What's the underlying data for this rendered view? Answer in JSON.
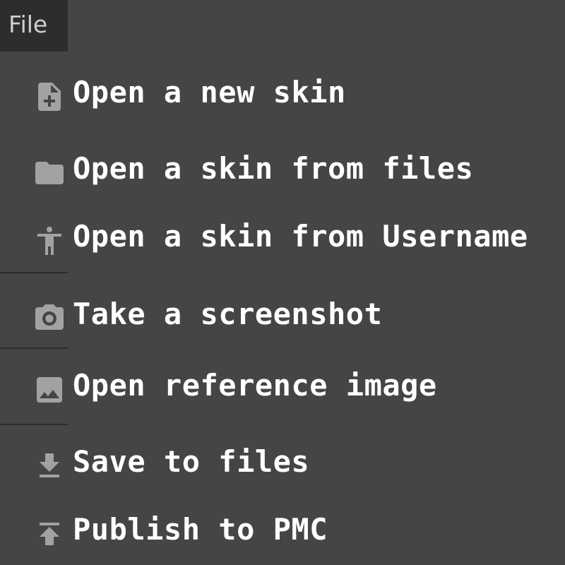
{
  "menu_bar": {
    "file_label": "File"
  },
  "menu": {
    "items": [
      {
        "label": "Open a new skin",
        "icon": "new-file-icon"
      },
      {
        "label": "Open a skin from files",
        "icon": "folder-icon"
      },
      {
        "label": "Open a skin from Username",
        "icon": "person-icon"
      },
      {
        "label": "Take a screenshot",
        "icon": "camera-icon"
      },
      {
        "label": "Open reference image",
        "icon": "image-icon"
      },
      {
        "label": "Save to files",
        "icon": "download-icon"
      },
      {
        "label": "Publish to PMC",
        "icon": "upload-icon"
      }
    ]
  },
  "colors": {
    "background": "#464444",
    "tab_background": "#2e2d2d",
    "text": "#ffffff",
    "icon": "#a3a2a2",
    "divider": "#2d2c2c"
  }
}
